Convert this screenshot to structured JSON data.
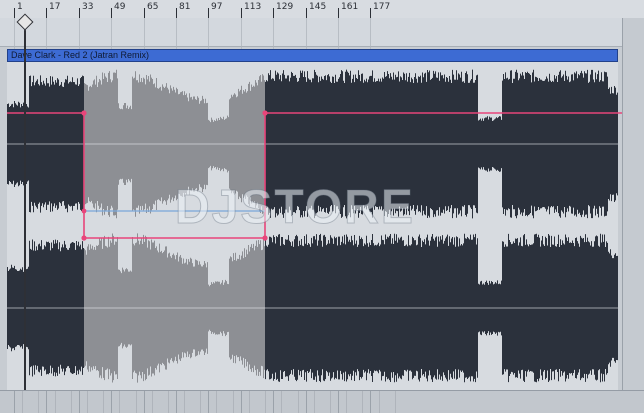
{
  "ruler": {
    "bars": [
      {
        "label": "1"
      },
      {
        "label": "17"
      },
      {
        "label": "33"
      },
      {
        "label": "49"
      },
      {
        "label": "65"
      },
      {
        "label": "81"
      },
      {
        "label": "97"
      },
      {
        "label": "113"
      },
      {
        "label": "129"
      },
      {
        "label": "145"
      },
      {
        "label": "161"
      },
      {
        "label": "177"
      }
    ]
  },
  "clip": {
    "title": "Dave Clark - Red 2 (Jatran Remix)",
    "color": "#3d6bd3",
    "waveform_color": "#2b313c",
    "muted_color": "#8d8f94"
  },
  "automation": {
    "color": "#e8457a",
    "secondary_color": "#7aa7d9"
  },
  "watermark": {
    "text": "DJSTORE"
  }
}
